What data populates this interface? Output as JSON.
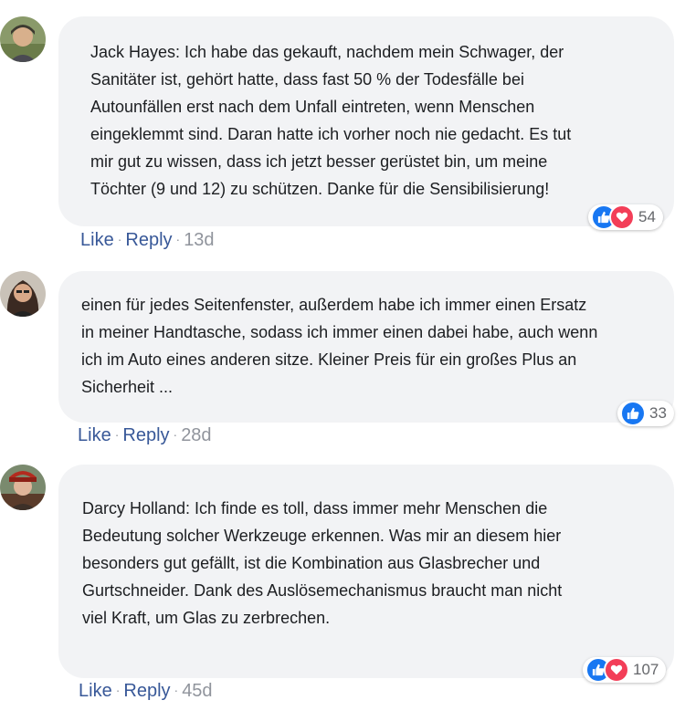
{
  "comments": [
    {
      "author": "Jack Hayes",
      "text_lines": [
        "Jack Hayes: Ich habe das gekauft, nachdem mein Schwager, der",
        "Sanitäter ist, gehört hatte, dass fast 50 % der Todesfälle bei",
        "Autounfällen erst nach dem Unfall eintreten, wenn Menschen",
        "eingeklemmt sind. Daran hatte ich vorher noch nie gedacht. Es tut",
        "mir gut zu wissen, dass ich jetzt besser gerüstet bin, um meine",
        "Töchter (9 und 12) zu schützen. Danke für die Sensibilisierung!"
      ],
      "reactions": [
        "like",
        "love"
      ],
      "reaction_count": "54",
      "like_label": "Like",
      "reply_label": "Reply",
      "time": "13d"
    },
    {
      "author": "",
      "text_lines": [
        "einen für jedes Seitenfenster, außerdem habe ich immer einen Ersatz",
        "in meiner Handtasche, sodass ich immer einen dabei habe, auch wenn",
        "ich im Auto eines anderen sitze. Kleiner Preis für ein großes Plus an",
        "Sicherheit ..."
      ],
      "reactions": [
        "like"
      ],
      "reaction_count": "33",
      "like_label": "Like",
      "reply_label": "Reply",
      "time": "28d"
    },
    {
      "author": "Darcy Holland",
      "text_lines": [
        "Darcy Holland: Ich finde es toll, dass immer mehr Menschen die",
        "Bedeutung solcher Werkzeuge erkennen. Was mir an diesem hier",
        "besonders gut gefällt, ist die Kombination aus Glasbrecher und",
        "Gurtschneider. Dank des Auslösemechanismus braucht man nicht",
        "viel Kraft, um Glas zu zerbrechen."
      ],
      "reactions": [
        "like",
        "love"
      ],
      "reaction_count": "107",
      "like_label": "Like",
      "reply_label": "Reply",
      "time": "45d"
    }
  ],
  "colors": {
    "bubble": "#f2f3f5",
    "link": "#385898",
    "like": "#1877f2",
    "love": "#f33e58"
  }
}
